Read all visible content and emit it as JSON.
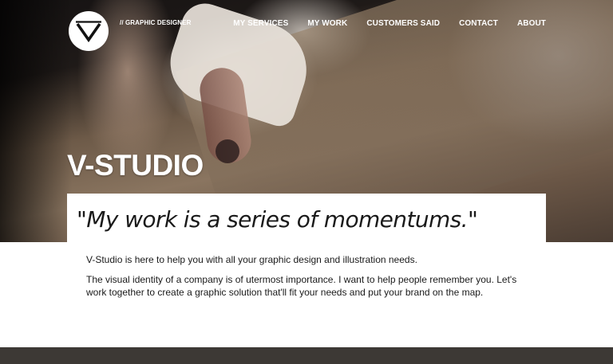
{
  "header": {
    "tagline": "// GRAPHIC DESIGNER",
    "nav": [
      {
        "label": "MY SERVICES"
      },
      {
        "label": "MY WORK"
      },
      {
        "label": "CUSTOMERS SAID"
      },
      {
        "label": "CONTACT"
      },
      {
        "label": "ABOUT"
      }
    ]
  },
  "hero": {
    "title": "V-STUDIO",
    "quote": "\"My work is a series of momentums.\""
  },
  "intro": {
    "paragraph_1": "V-Studio is here to help you with all your graphic design and illustration needs.",
    "paragraph_2": "The visual identity of a company is of utermost importance. I want to help people remember you. Let's work together to create a graphic solution that'll fit your needs and put your brand on the map."
  },
  "colors": {
    "text": "#1a1a1a",
    "nav_text": "#ffffff",
    "footer_band": "#3d3935"
  }
}
